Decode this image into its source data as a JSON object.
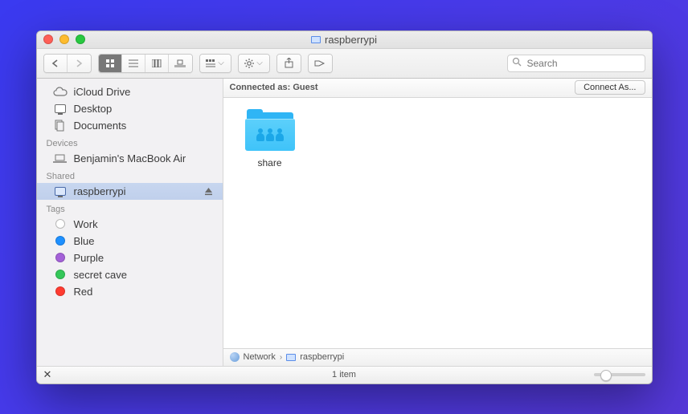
{
  "window": {
    "title": "raspberrypi"
  },
  "search": {
    "placeholder": "Search"
  },
  "sidebar": {
    "favorites": [
      {
        "label": "iCloud Drive",
        "icon": "cloud"
      },
      {
        "label": "Desktop",
        "icon": "desktop"
      },
      {
        "label": "Documents",
        "icon": "documents"
      }
    ],
    "sections": {
      "devices": "Devices",
      "shared": "Shared",
      "tags": "Tags"
    },
    "devices": [
      {
        "label": "Benjamin's MacBook Air"
      }
    ],
    "shared": [
      {
        "label": "raspberrypi",
        "selected": true
      }
    ],
    "tags": [
      {
        "label": "Work",
        "color": "#ffffff"
      },
      {
        "label": "Blue",
        "color": "#1e90ff"
      },
      {
        "label": "Purple",
        "color": "#a461d8"
      },
      {
        "label": "secret cave",
        "color": "#34c759"
      },
      {
        "label": "Red",
        "color": "#ff3b30"
      }
    ]
  },
  "infobar": {
    "connected_as": "Connected as: Guest",
    "connect_button": "Connect As..."
  },
  "content": {
    "items": [
      {
        "name": "share",
        "type": "shared-folder"
      }
    ]
  },
  "pathbar": {
    "segments": [
      "Network",
      "raspberrypi"
    ]
  },
  "statusbar": {
    "text": "1 item"
  }
}
